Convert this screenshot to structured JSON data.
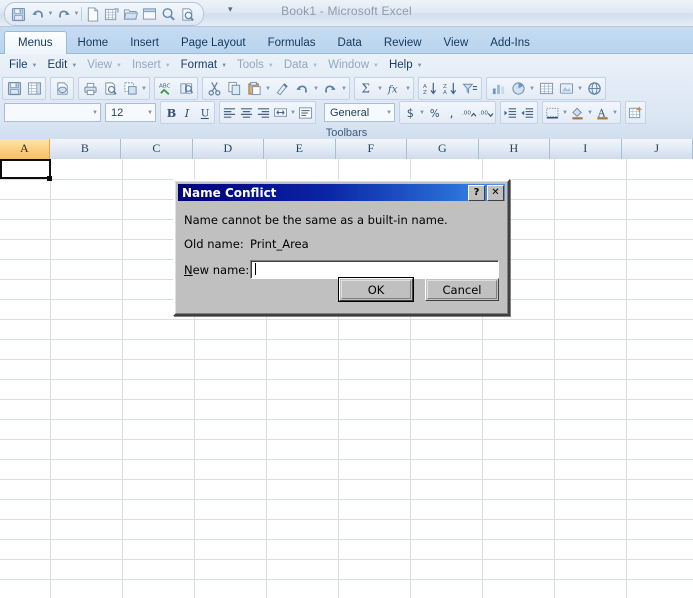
{
  "window": {
    "title": "Book1  -  Microsoft Excel",
    "doc_name": "Book1",
    "app_name": "Microsoft Excel"
  },
  "quick_access": {
    "items": [
      {
        "name": "save-icon",
        "label": "Save"
      },
      {
        "name": "undo-icon",
        "label": "Undo"
      },
      {
        "name": "redo-icon",
        "label": "Redo"
      },
      {
        "name": "new-icon",
        "label": "New"
      },
      {
        "name": "new-workbook-icon",
        "label": "New Workbook"
      },
      {
        "name": "open-icon",
        "label": "Open"
      },
      {
        "name": "window-icon",
        "label": "Window"
      },
      {
        "name": "find-icon",
        "label": "Find"
      },
      {
        "name": "print-preview-icon",
        "label": "Print Preview"
      }
    ],
    "more_label": "▾"
  },
  "tabs": [
    {
      "label": "Menus",
      "active": true
    },
    {
      "label": "Home",
      "active": false
    },
    {
      "label": "Insert",
      "active": false
    },
    {
      "label": "Page Layout",
      "active": false
    },
    {
      "label": "Formulas",
      "active": false
    },
    {
      "label": "Data",
      "active": false
    },
    {
      "label": "Review",
      "active": false
    },
    {
      "label": "View",
      "active": false
    },
    {
      "label": "Add-Ins",
      "active": false
    }
  ],
  "menubar": [
    {
      "label": "File",
      "dim": false,
      "arrow": "▾"
    },
    {
      "label": "Edit",
      "dim": false,
      "arrow": "▾"
    },
    {
      "label": "View",
      "dim": true,
      "arrow": "▾"
    },
    {
      "label": "Insert",
      "dim": true,
      "arrow": "▾"
    },
    {
      "label": "Format",
      "dim": false,
      "arrow": "▾"
    },
    {
      "label": "Tools",
      "dim": true,
      "arrow": "▾"
    },
    {
      "label": "Data",
      "dim": true,
      "arrow": "▾"
    },
    {
      "label": "Window",
      "dim": true,
      "arrow": "▾"
    },
    {
      "label": "Help",
      "dim": false,
      "arrow": "▾"
    }
  ],
  "ribbon": {
    "group_label": "Toolbars",
    "font_name_value": "",
    "font_size_value": "12",
    "number_format_value": "General"
  },
  "sheet": {
    "columns": [
      "A",
      "B",
      "C",
      "D",
      "E",
      "F",
      "G",
      "H",
      "I",
      "J"
    ],
    "selected_column": "A",
    "selected_cell": "A1",
    "row_count": 22
  },
  "dialog": {
    "title": "Name Conflict",
    "help_button": "?",
    "close_button": "✕",
    "message": "Name cannot be the same as a built-in name.",
    "old_name_label": "Old name:",
    "old_name_value": "Print_Area",
    "new_name_label_prefix": "N",
    "new_name_label_rest": "ew name:",
    "new_name_value": "",
    "ok_label": "OK",
    "cancel_label": "Cancel"
  },
  "colors": {
    "dialog_face": "#c0c0c0",
    "title_gradient_start": "#00007b",
    "title_gradient_end": "#4d95e8",
    "selected_column_header": "#f6bf63",
    "ribbon_tab_active": "#fdfefe",
    "grid_line": "#d6dfe8"
  }
}
